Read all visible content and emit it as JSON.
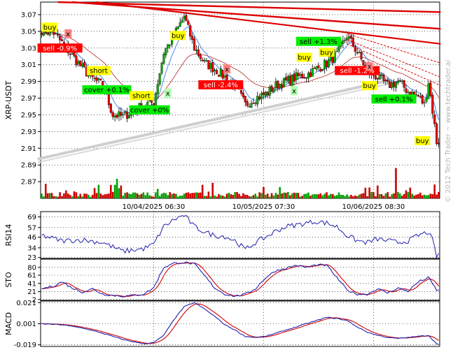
{
  "chart_data": {
    "type": "candlestick",
    "symbol": "XRP-USDT",
    "watermark": "© 2012 Tech Trader ~ www.techtrader.ai",
    "date_labels": [
      {
        "label": "10/04/2025 06:30",
        "index": 55
      },
      {
        "label": "10/05/2025 07:30",
        "index": 109
      },
      {
        "label": "10/06/2025 08:30",
        "index": 163
      }
    ],
    "price_panel": {
      "ylabel": "XRP-USDT",
      "ylim": [
        2.85,
        3.085
      ],
      "ticks": [
        "3.07",
        "3.05",
        "3.03",
        "3.01",
        "2.99",
        "2.97",
        "2.95",
        "2.93",
        "2.91",
        "2.89",
        "2.87"
      ],
      "anchors": [
        {
          "i": 0,
          "p": 3.052
        },
        {
          "i": 6,
          "p": 3.048
        },
        {
          "i": 12,
          "p": 3.03
        },
        {
          "i": 18,
          "p": 3.012
        },
        {
          "i": 24,
          "p": 2.995
        },
        {
          "i": 30,
          "p": 2.985
        },
        {
          "i": 35,
          "p": 2.95
        },
        {
          "i": 40,
          "p": 2.948
        },
        {
          "i": 45,
          "p": 2.955
        },
        {
          "i": 50,
          "p": 2.962
        },
        {
          "i": 55,
          "p": 2.965
        },
        {
          "i": 60,
          "p": 3.025
        },
        {
          "i": 65,
          "p": 3.045
        },
        {
          "i": 70,
          "p": 3.068
        },
        {
          "i": 75,
          "p": 3.03
        },
        {
          "i": 80,
          "p": 3.012
        },
        {
          "i": 85,
          "p": 3.005
        },
        {
          "i": 90,
          "p": 2.995
        },
        {
          "i": 95,
          "p": 2.985
        },
        {
          "i": 100,
          "p": 2.962
        },
        {
          "i": 105,
          "p": 2.97
        },
        {
          "i": 110,
          "p": 2.975
        },
        {
          "i": 115,
          "p": 2.985
        },
        {
          "i": 120,
          "p": 2.99
        },
        {
          "i": 125,
          "p": 2.995
        },
        {
          "i": 130,
          "p": 2.998
        },
        {
          "i": 135,
          "p": 3.005
        },
        {
          "i": 140,
          "p": 3.012
        },
        {
          "i": 145,
          "p": 3.022
        },
        {
          "i": 150,
          "p": 3.045
        },
        {
          "i": 155,
          "p": 3.025
        },
        {
          "i": 160,
          "p": 3.002
        },
        {
          "i": 165,
          "p": 2.995
        },
        {
          "i": 170,
          "p": 2.985
        },
        {
          "i": 175,
          "p": 2.99
        },
        {
          "i": 180,
          "p": 2.978
        },
        {
          "i": 185,
          "p": 2.972
        },
        {
          "i": 188,
          "p": 2.962
        },
        {
          "i": 190,
          "p": 2.99
        },
        {
          "i": 192,
          "p": 2.955
        },
        {
          "i": 194,
          "p": 2.918
        }
      ],
      "volume_spikes": [
        {
          "i": 37,
          "v": 1.0,
          "color": "green"
        },
        {
          "i": 174,
          "v": 1.55,
          "color": "red"
        }
      ],
      "channel_lines": [
        {
          "from": {
            "i": -2,
            "p": 2.897
          },
          "to": {
            "i": 172,
            "p": 2.992
          },
          "color": "#cfcfcf",
          "width": 4
        },
        {
          "from": {
            "i": -2,
            "p": 2.893
          },
          "to": {
            "i": 172,
            "p": 2.988
          },
          "color": "#d9d9d9",
          "width": 2
        }
      ],
      "trend_lines": [
        {
          "from": {
            "i": 8,
            "p": 3.085
          },
          "to": {
            "i": 196,
            "p": 3.073
          },
          "color": "#dd0000",
          "width": 2.4
        },
        {
          "from": {
            "i": 15,
            "p": 3.085
          },
          "to": {
            "i": 196,
            "p": 3.053
          },
          "color": "#dd0000",
          "width": 2.4
        },
        {
          "from": {
            "i": 27,
            "p": 3.085
          },
          "to": {
            "i": 196,
            "p": 3.035
          },
          "color": "#dd0000",
          "width": 2.2
        },
        {
          "from": {
            "i": 150,
            "p": 3.047
          },
          "to": {
            "i": 196,
            "p": 3.012
          },
          "color": "#dd0000",
          "width": 1,
          "dash": "3,2"
        },
        {
          "from": {
            "i": 150,
            "p": 3.04
          },
          "to": {
            "i": 196,
            "p": 2.995
          },
          "color": "#dd0000",
          "width": 1,
          "dash": "3,2"
        },
        {
          "from": {
            "i": 150,
            "p": 3.035
          },
          "to": {
            "i": 196,
            "p": 2.985
          },
          "color": "#dd0000",
          "width": 1,
          "dash": "3,2"
        }
      ],
      "annotations": [
        {
          "text": "buy",
          "i": 4,
          "p": 3.055,
          "bg": "#ffff00",
          "fg": "#000000"
        },
        {
          "text": "x",
          "i": 13,
          "p": 3.047,
          "bg": "#ff8080",
          "fg": "#000000"
        },
        {
          "text": "sell -0.9%",
          "i": 9,
          "p": 3.03,
          "bg": "#ff0000",
          "fg": "#ffffff"
        },
        {
          "text": "short",
          "i": 28,
          "p": 3.003,
          "bg": "#ffff00",
          "fg": "#000000"
        },
        {
          "text": "cover +0.1%",
          "i": 32,
          "p": 2.98,
          "bg": "#00ee00",
          "fg": "#000000"
        },
        {
          "text": "short",
          "i": 49,
          "p": 2.973,
          "bg": "#ffff00",
          "fg": "#000000"
        },
        {
          "text": "cover +0%",
          "i": 53,
          "p": 2.956,
          "bg": "#00ee00",
          "fg": "#000000"
        },
        {
          "text": "buy",
          "i": 67,
          "p": 3.045,
          "bg": "#ffff00",
          "fg": "#000000"
        },
        {
          "text": "x",
          "i": 62,
          "p": 2.976,
          "bg": "#b0ffb0",
          "fg": "#000000"
        },
        {
          "text": "x",
          "i": 91,
          "p": 3.005,
          "bg": "#ff8080",
          "fg": "#000000"
        },
        {
          "text": "sell -2.4%",
          "i": 88,
          "p": 2.986,
          "bg": "#ff0000",
          "fg": "#ffffff"
        },
        {
          "text": "buy",
          "i": 129,
          "p": 3.019,
          "bg": "#ffff00",
          "fg": "#000000"
        },
        {
          "text": "sell +1.3%",
          "i": 136,
          "p": 3.038,
          "bg": "#00ee00",
          "fg": "#000000"
        },
        {
          "text": "x",
          "i": 124,
          "p": 2.979,
          "bg": "#b0ffb0",
          "fg": "#000000"
        },
        {
          "text": "buy",
          "i": 140,
          "p": 3.025,
          "bg": "#ffff00",
          "fg": "#000000"
        },
        {
          "text": "sell -1.2%",
          "i": 155,
          "p": 3.003,
          "bg": "#ff0000",
          "fg": "#ffffff"
        },
        {
          "text": "x",
          "i": 161,
          "p": 3.008,
          "bg": "#ff8080",
          "fg": "#000000"
        },
        {
          "text": "buy",
          "i": 161,
          "p": 2.985,
          "bg": "#ffff00",
          "fg": "#000000"
        },
        {
          "text": "sell +0.1%",
          "i": 173,
          "p": 2.969,
          "bg": "#00ee00",
          "fg": "#000000"
        },
        {
          "text": "buy",
          "i": 187,
          "p": 2.919,
          "bg": "#ffff00",
          "fg": "#000000"
        }
      ]
    },
    "rsi_panel": {
      "ylabel": "RSI14",
      "ylim": [
        22,
        75
      ],
      "ticks": [
        "69",
        "57",
        "46",
        "34",
        "23"
      ],
      "anchors": [
        {
          "i": 0,
          "v": 48
        },
        {
          "i": 10,
          "v": 42
        },
        {
          "i": 20,
          "v": 43
        },
        {
          "i": 30,
          "v": 40
        },
        {
          "i": 40,
          "v": 30
        },
        {
          "i": 50,
          "v": 33
        },
        {
          "i": 55,
          "v": 38
        },
        {
          "i": 60,
          "v": 58
        },
        {
          "i": 65,
          "v": 66
        },
        {
          "i": 70,
          "v": 71
        },
        {
          "i": 75,
          "v": 58
        },
        {
          "i": 80,
          "v": 52
        },
        {
          "i": 85,
          "v": 48
        },
        {
          "i": 90,
          "v": 47
        },
        {
          "i": 95,
          "v": 42
        },
        {
          "i": 100,
          "v": 32
        },
        {
          "i": 105,
          "v": 40
        },
        {
          "i": 110,
          "v": 46
        },
        {
          "i": 115,
          "v": 53
        },
        {
          "i": 120,
          "v": 58
        },
        {
          "i": 125,
          "v": 60
        },
        {
          "i": 130,
          "v": 62
        },
        {
          "i": 135,
          "v": 64
        },
        {
          "i": 140,
          "v": 62
        },
        {
          "i": 145,
          "v": 58
        },
        {
          "i": 150,
          "v": 48
        },
        {
          "i": 155,
          "v": 42
        },
        {
          "i": 160,
          "v": 40
        },
        {
          "i": 165,
          "v": 44
        },
        {
          "i": 170,
          "v": 42
        },
        {
          "i": 175,
          "v": 40
        },
        {
          "i": 180,
          "v": 42
        },
        {
          "i": 185,
          "v": 48
        },
        {
          "i": 190,
          "v": 52
        },
        {
          "i": 192,
          "v": 42
        },
        {
          "i": 194,
          "v": 25
        }
      ]
    },
    "sto_panel": {
      "ylabel": "STO",
      "ylim": [
        0,
        100
      ],
      "ticks": [
        "80",
        "61",
        "41",
        "21",
        "2"
      ],
      "anchors": [
        {
          "i": 0,
          "v": 28
        },
        {
          "i": 6,
          "v": 35
        },
        {
          "i": 10,
          "v": 45
        },
        {
          "i": 15,
          "v": 30
        },
        {
          "i": 20,
          "v": 20
        },
        {
          "i": 25,
          "v": 28
        },
        {
          "i": 30,
          "v": 15
        },
        {
          "i": 35,
          "v": 12
        },
        {
          "i": 40,
          "v": 10
        },
        {
          "i": 45,
          "v": 12
        },
        {
          "i": 50,
          "v": 15
        },
        {
          "i": 55,
          "v": 30
        },
        {
          "i": 60,
          "v": 80
        },
        {
          "i": 65,
          "v": 90
        },
        {
          "i": 70,
          "v": 92
        },
        {
          "i": 75,
          "v": 88
        },
        {
          "i": 80,
          "v": 60
        },
        {
          "i": 85,
          "v": 30
        },
        {
          "i": 90,
          "v": 15
        },
        {
          "i": 95,
          "v": 10
        },
        {
          "i": 100,
          "v": 15
        },
        {
          "i": 105,
          "v": 28
        },
        {
          "i": 110,
          "v": 55
        },
        {
          "i": 115,
          "v": 72
        },
        {
          "i": 120,
          "v": 78
        },
        {
          "i": 125,
          "v": 85
        },
        {
          "i": 130,
          "v": 80
        },
        {
          "i": 135,
          "v": 86
        },
        {
          "i": 140,
          "v": 85
        },
        {
          "i": 145,
          "v": 55
        },
        {
          "i": 150,
          "v": 25
        },
        {
          "i": 155,
          "v": 15
        },
        {
          "i": 160,
          "v": 15
        },
        {
          "i": 165,
          "v": 28
        },
        {
          "i": 170,
          "v": 18
        },
        {
          "i": 175,
          "v": 30
        },
        {
          "i": 180,
          "v": 22
        },
        {
          "i": 185,
          "v": 45
        },
        {
          "i": 190,
          "v": 55
        },
        {
          "i": 194,
          "v": 25
        }
      ],
      "lag": 4
    },
    "macd_panel": {
      "ylabel": "MACD",
      "ylim": [
        -0.0205,
        0.0225
      ],
      "ticks": [
        "0.021",
        "0.001",
        "-0.019"
      ],
      "anchors": [
        {
          "i": 0,
          "v": 0.001
        },
        {
          "i": 10,
          "v": 0.0
        },
        {
          "i": 20,
          "v": -0.003
        },
        {
          "i": 30,
          "v": -0.008
        },
        {
          "i": 40,
          "v": -0.014
        },
        {
          "i": 50,
          "v": -0.018
        },
        {
          "i": 55,
          "v": -0.017
        },
        {
          "i": 60,
          "v": -0.01
        },
        {
          "i": 65,
          "v": 0.005
        },
        {
          "i": 70,
          "v": 0.017
        },
        {
          "i": 75,
          "v": 0.021
        },
        {
          "i": 80,
          "v": 0.015
        },
        {
          "i": 85,
          "v": 0.008
        },
        {
          "i": 90,
          "v": 0.0
        },
        {
          "i": 95,
          "v": -0.005
        },
        {
          "i": 100,
          "v": -0.011
        },
        {
          "i": 105,
          "v": -0.012
        },
        {
          "i": 110,
          "v": -0.011
        },
        {
          "i": 115,
          "v": -0.008
        },
        {
          "i": 120,
          "v": -0.005
        },
        {
          "i": 125,
          "v": -0.002
        },
        {
          "i": 130,
          "v": 0.001
        },
        {
          "i": 135,
          "v": 0.004
        },
        {
          "i": 140,
          "v": 0.007
        },
        {
          "i": 145,
          "v": 0.006
        },
        {
          "i": 150,
          "v": 0.004
        },
        {
          "i": 155,
          "v": -0.002
        },
        {
          "i": 160,
          "v": -0.007
        },
        {
          "i": 165,
          "v": -0.01
        },
        {
          "i": 170,
          "v": -0.012
        },
        {
          "i": 175,
          "v": -0.013
        },
        {
          "i": 180,
          "v": -0.012
        },
        {
          "i": 185,
          "v": -0.011
        },
        {
          "i": 190,
          "v": -0.01
        },
        {
          "i": 194,
          "v": -0.018
        }
      ],
      "lag": 5
    },
    "colors": {
      "up": "#00aa00",
      "down": "#dd0000",
      "wick": "#000000",
      "ma_fast": "#4a86e8",
      "ma_slow": "#c0504d",
      "indicator": "#1f1fae",
      "signal": "#cc0000",
      "volume_up": "#00a000",
      "volume_down": "#cc0000",
      "grid": "#000000"
    }
  }
}
